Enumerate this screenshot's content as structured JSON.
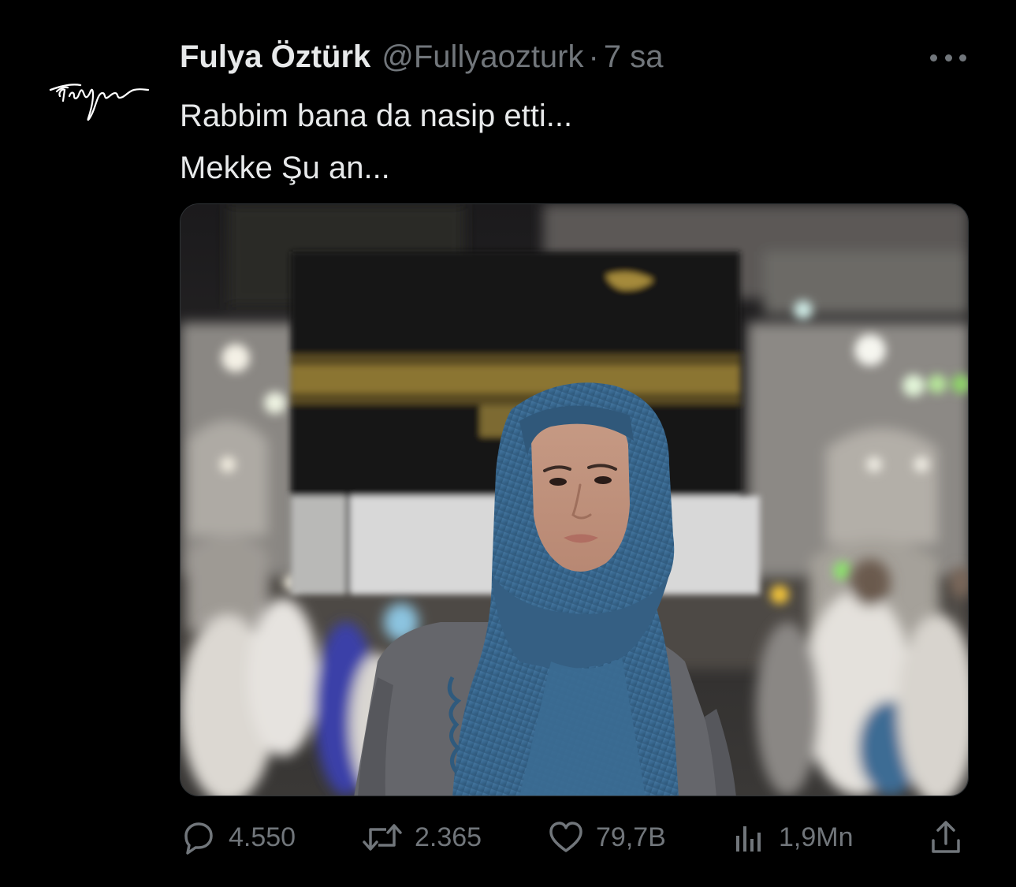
{
  "tweet": {
    "avatar_signature": "Fulya",
    "display_name": "Fulya Öztürk",
    "handle": "@Fullyaozturk",
    "separator": "·",
    "time": "7 sa",
    "lines": [
      "Rabbim bana da nasip etti...",
      "Mekke Şu an..."
    ],
    "media_icon": "photo",
    "more_icon": "more-horizontal-icon"
  },
  "actions": {
    "replies": "4.550",
    "reposts": "2.365",
    "likes": "79,7B",
    "views": "1,9Mn"
  },
  "colors": {
    "background": "#000000",
    "primary_text": "#e7e9ea",
    "secondary_text": "#71767b",
    "hijab_blue": "#3f6f97",
    "kiswah_gold": "#a58a3a"
  }
}
